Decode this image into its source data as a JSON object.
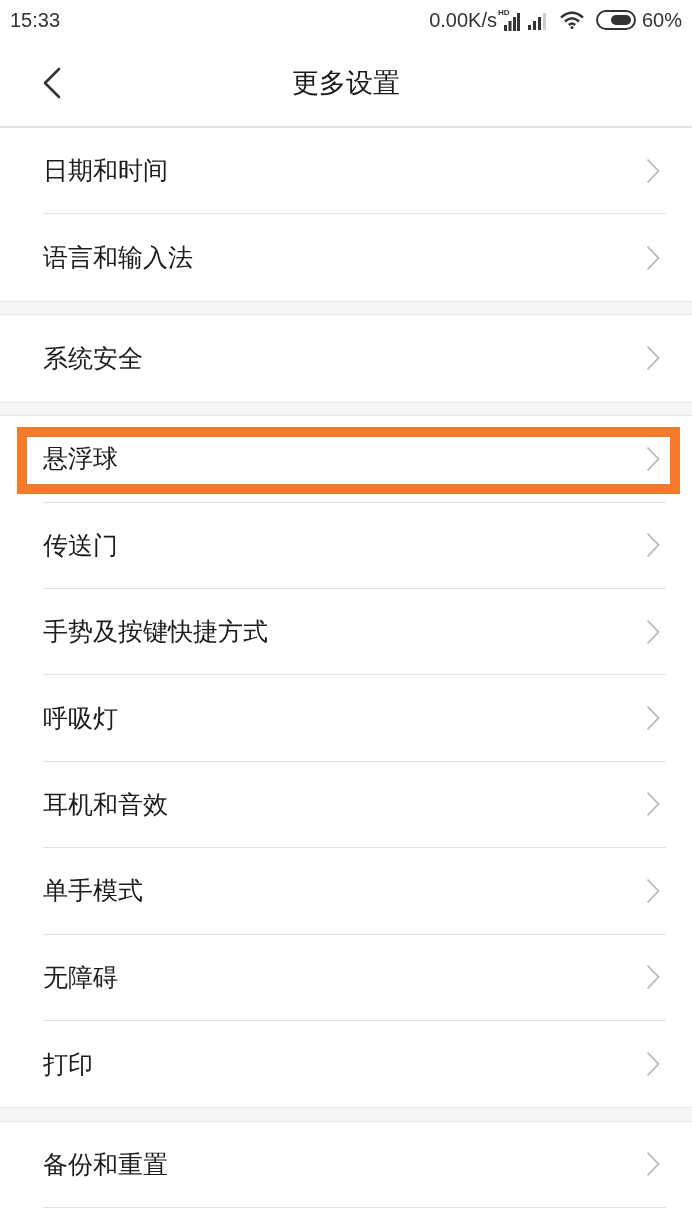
{
  "status_bar": {
    "time": "15:33",
    "net_speed": "0.00K/s",
    "network_badge": "HD",
    "battery": "60%"
  },
  "header": {
    "title": "更多设置"
  },
  "groups": [
    {
      "items": [
        {
          "label": "日期和时间",
          "highlighted": false
        },
        {
          "label": "语言和输入法",
          "highlighted": false
        }
      ]
    },
    {
      "items": [
        {
          "label": "系统安全",
          "highlighted": false
        }
      ]
    },
    {
      "items": [
        {
          "label": "悬浮球",
          "highlighted": true
        },
        {
          "label": "传送门",
          "highlighted": false
        },
        {
          "label": "手势及按键快捷方式",
          "highlighted": false
        },
        {
          "label": "呼吸灯",
          "highlighted": false
        },
        {
          "label": "耳机和音效",
          "highlighted": false
        },
        {
          "label": "单手模式",
          "highlighted": false
        },
        {
          "label": "无障碍",
          "highlighted": false
        },
        {
          "label": "打印",
          "highlighted": false
        }
      ]
    },
    {
      "items": [
        {
          "label": "备份和重置",
          "highlighted": false
        }
      ]
    }
  ]
}
